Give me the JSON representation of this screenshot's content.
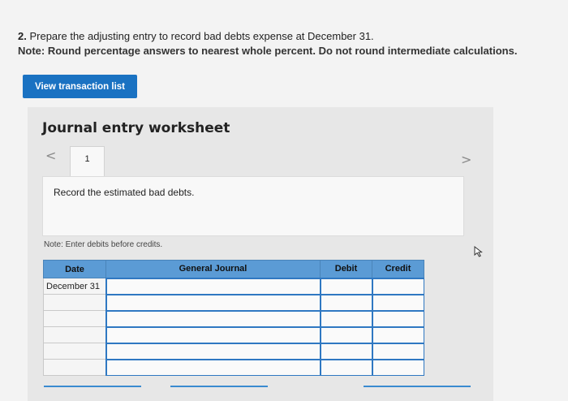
{
  "question": {
    "number": "2.",
    "line1": "Prepare the adjusting entry to record bad debts expense at December 31.",
    "note": "Note: Round percentage answers to nearest whole percent. Do not round intermediate calculations."
  },
  "view_button": {
    "label": "View transaction list"
  },
  "worksheet": {
    "title": "Journal entry worksheet",
    "tab_number": "1",
    "record_text": "Record the estimated bad debts.",
    "note": "Note: Enter debits before credits."
  },
  "journal": {
    "headers": [
      "Date",
      "General Journal",
      "Debit",
      "Credit"
    ],
    "rows": [
      {
        "date": "December 31",
        "account": "",
        "debit": "",
        "credit": ""
      },
      {
        "date": "",
        "account": "",
        "debit": "",
        "credit": ""
      },
      {
        "date": "",
        "account": "",
        "debit": "",
        "credit": ""
      },
      {
        "date": "",
        "account": "",
        "debit": "",
        "credit": ""
      },
      {
        "date": "",
        "account": "",
        "debit": "",
        "credit": ""
      },
      {
        "date": "",
        "account": "",
        "debit": "",
        "credit": ""
      }
    ]
  },
  "colors": {
    "button_blue": "#1a72c2",
    "header_blue": "#5b9bd5",
    "panel_gray": "#e7e7e7"
  },
  "icons": [
    "chevron-left-icon",
    "chevron-right-icon",
    "cursor-icon"
  ]
}
